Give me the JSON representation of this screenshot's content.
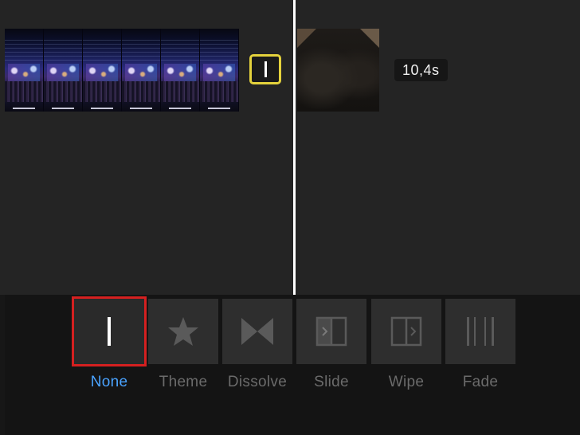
{
  "timeline": {
    "duration": "10,4s"
  },
  "transitions": [
    {
      "id": "none",
      "label": "None",
      "icon": "none-icon",
      "selected": true
    },
    {
      "id": "theme",
      "label": "Theme",
      "icon": "star-icon",
      "selected": false
    },
    {
      "id": "dissolve",
      "label": "Dissolve",
      "icon": "dissolve-icon",
      "selected": false
    },
    {
      "id": "slide",
      "label": "Slide",
      "icon": "slide-icon",
      "selected": false
    },
    {
      "id": "wipe",
      "label": "Wipe",
      "icon": "wipe-icon",
      "selected": false
    },
    {
      "id": "fade",
      "label": "Fade",
      "icon": "fade-icon",
      "selected": false
    }
  ],
  "colors": {
    "selected_border": "#d52020",
    "selected_label": "#4aa3ff",
    "transition_marker": "#e4d23c",
    "playhead": "#ffffff"
  }
}
